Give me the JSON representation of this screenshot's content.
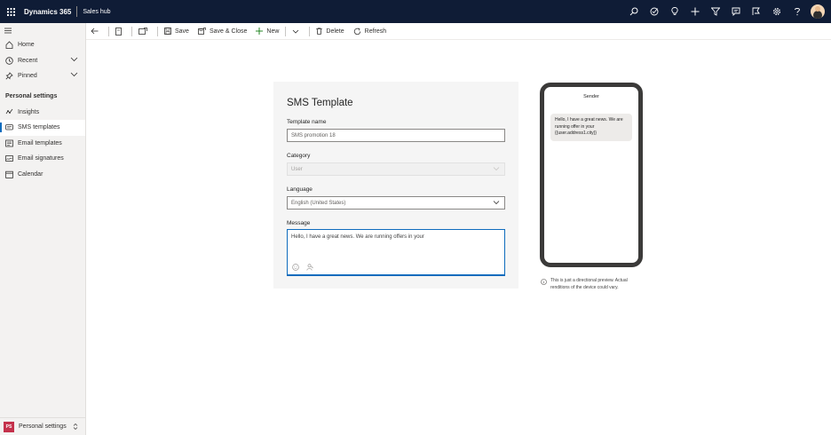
{
  "topbar": {
    "app_name": "Dynamics 365",
    "app_area": "Sales hub",
    "icons": [
      "search-icon",
      "task-icon",
      "lightbulb-icon",
      "plus-icon",
      "filter-icon",
      "chat-icon",
      "assist-icon",
      "gear-icon",
      "help-icon",
      "avatar"
    ]
  },
  "sidebar": {
    "items": [
      {
        "label": "Home",
        "icon": "home-icon"
      },
      {
        "label": "Recent",
        "icon": "clock-icon"
      },
      {
        "label": "Pinned",
        "icon": "pin-icon"
      }
    ],
    "section_title": "Personal settings",
    "settings_items": [
      {
        "label": "Insights",
        "icon": "insights-icon"
      },
      {
        "label": "SMS templates",
        "icon": "sms-icon"
      },
      {
        "label": "Email templates",
        "icon": "email-template-icon"
      },
      {
        "label": "Email signatures",
        "icon": "signature-icon"
      },
      {
        "label": "Calendar",
        "icon": "calendar-icon"
      }
    ],
    "footer": {
      "badge": "PS",
      "label": "Personal settings"
    }
  },
  "commandbar": {
    "save": "Save",
    "save_close": "Save & Close",
    "new": "New",
    "delete": "Delete",
    "refresh": "Refresh"
  },
  "form": {
    "title": "SMS Template",
    "template_name_label": "Template name",
    "template_name_value": "SMS promotion 18",
    "category_label": "Category",
    "category_value": "User",
    "language_label": "Language",
    "language_value": "English (United States)",
    "message_label": "Message",
    "message_value": "Hello, I have a great news. We are running offers in your"
  },
  "preview": {
    "sender": "Sender",
    "bubble_text": "Hello, I have a great news. We are running offer in your {{user.address1.city}}",
    "note": "This is just a directional preview. Actual renditions of the device could vary."
  },
  "colors": {
    "topbar": "#0f1c36",
    "accent": "#0f6cbd",
    "new_icon": "#107c10",
    "badge": "#c4314b"
  }
}
